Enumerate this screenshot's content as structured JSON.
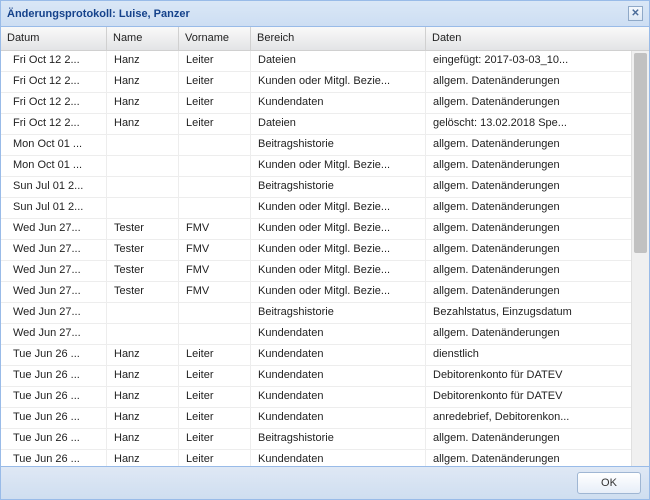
{
  "window": {
    "title": "Änderungsprotokoll: Luise, Panzer"
  },
  "columns": {
    "datum": "Datum",
    "name": "Name",
    "vorname": "Vorname",
    "bereich": "Bereich",
    "daten": "Daten"
  },
  "footer": {
    "ok": "OK"
  },
  "rows": [
    {
      "datum": "Fri Oct 12 2...",
      "name": "Hanz",
      "vorname": "Leiter",
      "bereich": "Dateien",
      "daten": "eingefügt: 2017-03-03_10..."
    },
    {
      "datum": "Fri Oct 12 2...",
      "name": "Hanz",
      "vorname": "Leiter",
      "bereich": "Kunden oder Mitgl. Bezie...",
      "daten": "allgem. Datenänderungen"
    },
    {
      "datum": "Fri Oct 12 2...",
      "name": "Hanz",
      "vorname": "Leiter",
      "bereich": "Kundendaten",
      "daten": "allgem. Datenänderungen"
    },
    {
      "datum": "Fri Oct 12 2...",
      "name": "Hanz",
      "vorname": "Leiter",
      "bereich": "Dateien",
      "daten": "gelöscht: 13.02.2018 Spe..."
    },
    {
      "datum": "Mon Oct 01 ...",
      "name": "",
      "vorname": "",
      "bereich": "Beitragshistorie",
      "daten": "allgem. Datenänderungen"
    },
    {
      "datum": "Mon Oct 01 ...",
      "name": "",
      "vorname": "",
      "bereich": "Kunden oder Mitgl. Bezie...",
      "daten": "allgem. Datenänderungen"
    },
    {
      "datum": "Sun Jul 01 2...",
      "name": "",
      "vorname": "",
      "bereich": "Beitragshistorie",
      "daten": "allgem. Datenänderungen"
    },
    {
      "datum": "Sun Jul 01 2...",
      "name": "",
      "vorname": "",
      "bereich": "Kunden oder Mitgl. Bezie...",
      "daten": "allgem. Datenänderungen"
    },
    {
      "datum": "Wed Jun 27...",
      "name": "Tester",
      "vorname": "FMV",
      "bereich": "Kunden oder Mitgl. Bezie...",
      "daten": "allgem. Datenänderungen"
    },
    {
      "datum": "Wed Jun 27...",
      "name": "Tester",
      "vorname": "FMV",
      "bereich": "Kunden oder Mitgl. Bezie...",
      "daten": "allgem. Datenänderungen"
    },
    {
      "datum": "Wed Jun 27...",
      "name": "Tester",
      "vorname": "FMV",
      "bereich": "Kunden oder Mitgl. Bezie...",
      "daten": "allgem. Datenänderungen"
    },
    {
      "datum": "Wed Jun 27...",
      "name": "Tester",
      "vorname": "FMV",
      "bereich": "Kunden oder Mitgl. Bezie...",
      "daten": "allgem. Datenänderungen"
    },
    {
      "datum": "Wed Jun 27...",
      "name": "",
      "vorname": "",
      "bereich": "Beitragshistorie",
      "daten": "Bezahlstatus, Einzugsdatum"
    },
    {
      "datum": "Wed Jun 27...",
      "name": "",
      "vorname": "",
      "bereich": "Kundendaten",
      "daten": "allgem. Datenänderungen"
    },
    {
      "datum": "Tue Jun 26 ...",
      "name": "Hanz",
      "vorname": "Leiter",
      "bereich": "Kundendaten",
      "daten": "dienstlich"
    },
    {
      "datum": "Tue Jun 26 ...",
      "name": "Hanz",
      "vorname": "Leiter",
      "bereich": "Kundendaten",
      "daten": "Debitorenkonto für DATEV"
    },
    {
      "datum": "Tue Jun 26 ...",
      "name": "Hanz",
      "vorname": "Leiter",
      "bereich": "Kundendaten",
      "daten": "Debitorenkonto für DATEV"
    },
    {
      "datum": "Tue Jun 26 ...",
      "name": "Hanz",
      "vorname": "Leiter",
      "bereich": "Kundendaten",
      "daten": "anredebrief, Debitorenkon..."
    },
    {
      "datum": "Tue Jun 26 ...",
      "name": "Hanz",
      "vorname": "Leiter",
      "bereich": "Beitragshistorie",
      "daten": "allgem. Datenänderungen"
    },
    {
      "datum": "Tue Jun 26 ...",
      "name": "Hanz",
      "vorname": "Leiter",
      "bereich": "Kundendaten",
      "daten": "allgem. Datenänderungen"
    }
  ]
}
